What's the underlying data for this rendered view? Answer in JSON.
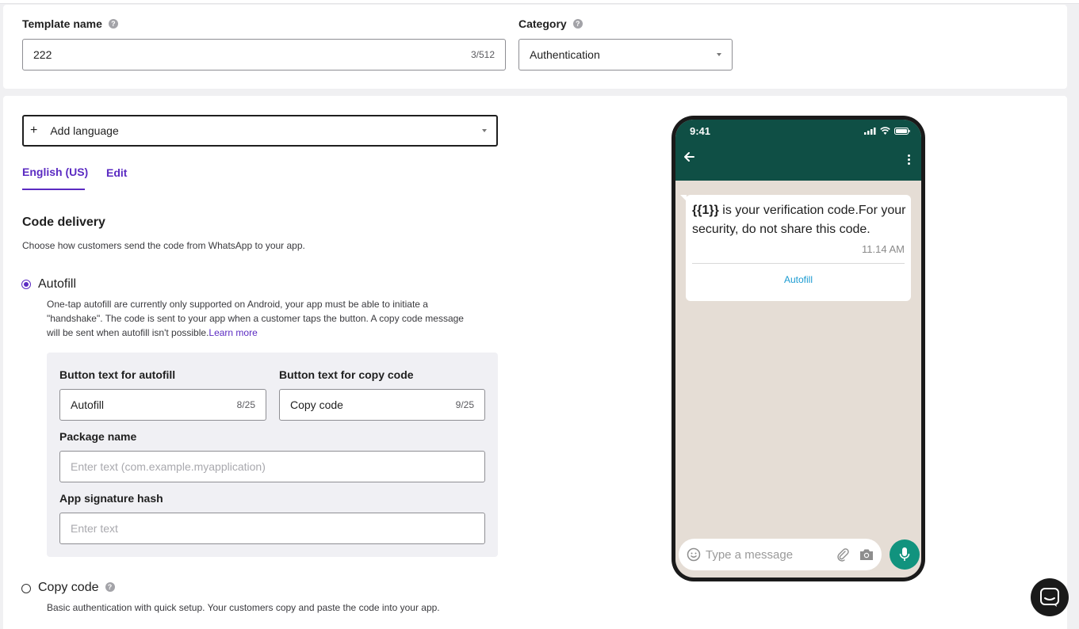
{
  "template": {
    "name_label": "Template name",
    "name_value": "222",
    "name_counter": "3/512",
    "category_label": "Category",
    "category_value": "Authentication"
  },
  "language": {
    "add_label": "Add language",
    "tab_active": "English (US)",
    "tab_edit": "Edit"
  },
  "code_delivery": {
    "title": "Code delivery",
    "description": "Choose how customers send the code from WhatsApp to your app.",
    "autofill": {
      "label": "Autofill",
      "selected": true,
      "desc_line1": "One-tap autofill are currently only supported on Android, your app must be able to initiate a",
      "desc_line2": "\"handshake\". The code is sent to your app when a customer taps the button. A copy code message",
      "desc_line3": "will be sent when autofill isn't possible.",
      "learn_more": "Learn more",
      "button_autofill_label": "Button text for autofill",
      "button_autofill_value": "Autofill",
      "button_autofill_counter": "8/25",
      "button_copy_label": "Button text for copy code",
      "button_copy_value": "Copy code",
      "button_copy_counter": "9/25",
      "package_label": "Package name",
      "package_placeholder": "Enter text (com.example.myapplication)",
      "hash_label": "App signature hash",
      "hash_placeholder": "Enter text"
    },
    "copy_code": {
      "label": "Copy code",
      "selected": false,
      "description": "Basic authentication with quick setup. Your customers copy and paste the code into your app."
    }
  },
  "preview": {
    "clock": "9:41",
    "message_var": "{{1}}",
    "message_text": " is your verification code.For your security, do not share this code.",
    "message_time": "11.14 AM",
    "message_button": "Autofill",
    "input_placeholder": "Type a message",
    "header_color": "#0f4f45",
    "accent_green": "#11937e"
  },
  "colors": {
    "accent": "#5b2bc2"
  }
}
